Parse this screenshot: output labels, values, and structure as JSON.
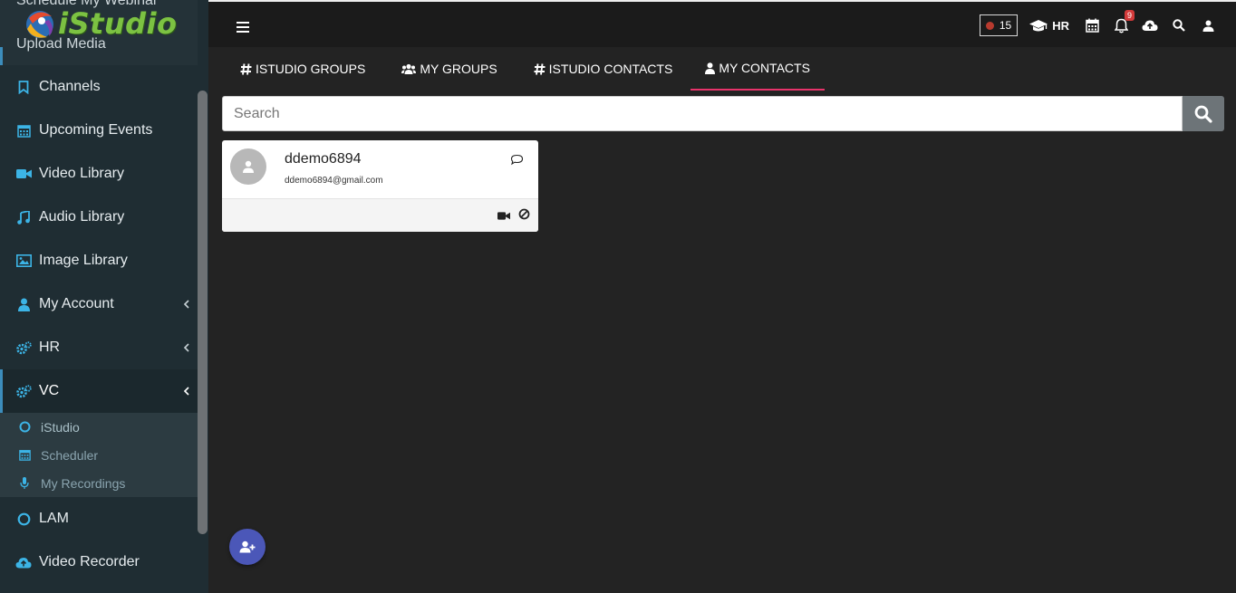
{
  "app": {
    "logo_text": "iStudio"
  },
  "sidebar": {
    "partial_top": "Schedule My Webinar",
    "partial_bottom": "Upload Media",
    "items": [
      {
        "label": "Channels",
        "icon": "bookmark-icon"
      },
      {
        "label": "Upcoming Events",
        "icon": "calendar-icon"
      },
      {
        "label": "Video Library",
        "icon": "video-icon"
      },
      {
        "label": "Audio Library",
        "icon": "music-icon"
      },
      {
        "label": "Image Library",
        "icon": "image-icon"
      },
      {
        "label": "My Account",
        "icon": "user-icon"
      },
      {
        "label": "HR",
        "icon": "cogs-icon"
      },
      {
        "label": "VC",
        "icon": "cogs-icon"
      },
      {
        "label": "LAM",
        "icon": "circle-icon"
      },
      {
        "label": "Video Recorder",
        "icon": "cloud-upload-icon"
      }
    ],
    "vc_submenu": [
      {
        "label": "iStudio",
        "icon": "circle-icon"
      },
      {
        "label": "Scheduler",
        "icon": "calendar-icon"
      },
      {
        "label": "My Recordings",
        "icon": "microphone-icon"
      }
    ]
  },
  "header": {
    "recording_count": "15",
    "hr_label": "HR",
    "notification_count": "9"
  },
  "tabs": [
    {
      "label": "ISTUDIO GROUPS",
      "icon": "hash-icon"
    },
    {
      "label": "MY GROUPS",
      "icon": "users-icon"
    },
    {
      "label": "ISTUDIO CONTACTS",
      "icon": "hash-icon"
    },
    {
      "label": "MY CONTACTS",
      "icon": "user-icon",
      "active": true
    }
  ],
  "search": {
    "placeholder": "Search",
    "value": ""
  },
  "contacts": [
    {
      "name": "ddemo6894",
      "email": "ddemo6894@gmail.com"
    }
  ],
  "colors": {
    "accent_tab": "#e8336b",
    "sidebar_bg": "#1f2d33",
    "fab": "#4b57b8",
    "icon_blue": "#3cb4e6"
  }
}
